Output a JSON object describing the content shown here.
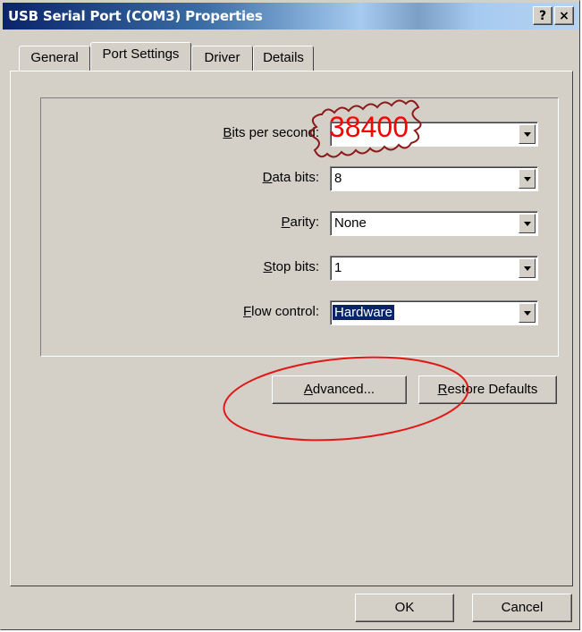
{
  "window": {
    "title": "USB Serial Port (COM3) Properties",
    "help_button": "?",
    "close_button": "×"
  },
  "tabs": [
    {
      "label": "General",
      "active": false
    },
    {
      "label": "Port Settings",
      "active": true
    },
    {
      "label": "Driver",
      "active": false
    },
    {
      "label": "Details",
      "active": false
    }
  ],
  "settings": {
    "bits_per_second": {
      "accel": "B",
      "rest": "its per second:",
      "value": "38400"
    },
    "data_bits": {
      "accel": "D",
      "rest": "ata bits:",
      "value": "8"
    },
    "parity": {
      "accel": "P",
      "rest": "arity:",
      "value": "None"
    },
    "stop_bits": {
      "accel": "S",
      "rest": "top bits:",
      "value": "1"
    },
    "flow_control": {
      "accel": "F",
      "rest": "low control:",
      "value": "Hardware"
    }
  },
  "buttons": {
    "advanced": {
      "accel": "A",
      "rest": "dvanced..."
    },
    "restore_defaults": {
      "accel": "R",
      "rest": "estore Defaults"
    },
    "ok": "OK",
    "cancel": "Cancel"
  },
  "annotation": {
    "value": "38400",
    "color": "#ff0000",
    "cloud_color": "#8b1a1a"
  },
  "colors": {
    "face": "#d4d0c8",
    "title_start": "#0a246a",
    "selection": "#0a246a"
  }
}
